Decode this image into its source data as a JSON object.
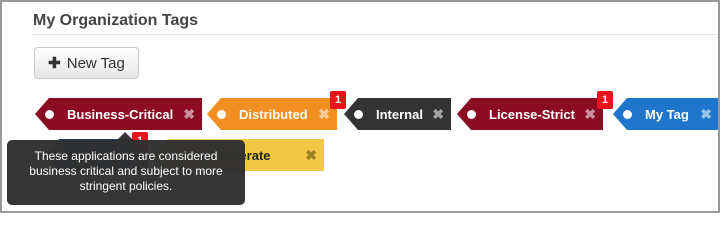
{
  "page": {
    "title": "My Organization Tags"
  },
  "toolbar": {
    "new_tag_label": "New Tag"
  },
  "tags": [
    {
      "label": "Business-Critical",
      "color": "#8b0b23",
      "badge": ""
    },
    {
      "label": "Distributed",
      "color": "#f28e22",
      "badge": "1"
    },
    {
      "label": "Internal",
      "color": "#333333",
      "badge": ""
    },
    {
      "label": "License-Strict",
      "color": "#8b0b23",
      "badge": "1"
    },
    {
      "label": "My Tag",
      "color": "#1f75cc",
      "badge": ""
    },
    {
      "label": "",
      "color": "#1f3f73",
      "badge": "1"
    },
    {
      "label": "...ty-Moderate",
      "color": "#f2c744",
      "badge": ""
    }
  ],
  "tooltip": {
    "text": "These applications are considered business critical and subject to more stringent policies."
  },
  "colors": {
    "badge": "#e8141c",
    "tooltip_bg": "#303030"
  },
  "icons": {
    "tag_close": "close-icon",
    "tag_hole": "tag-hole-icon",
    "add": "plus-icon"
  }
}
